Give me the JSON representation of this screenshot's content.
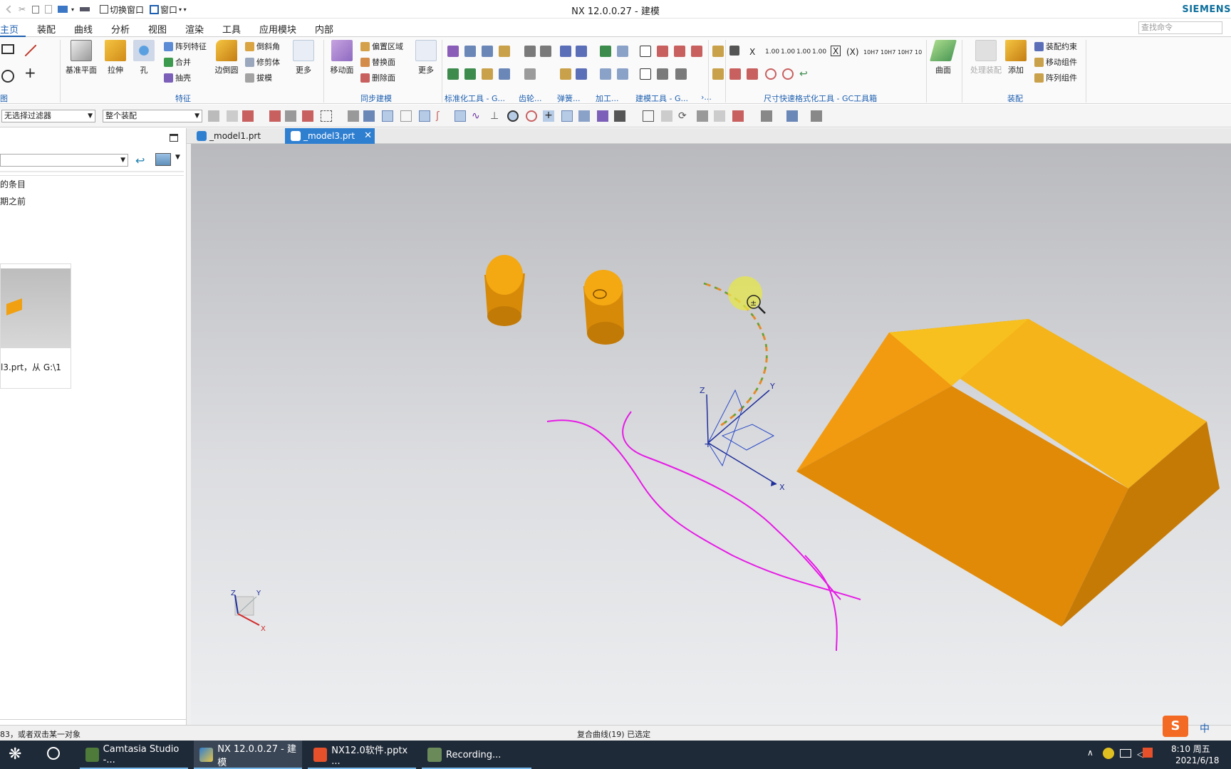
{
  "window": {
    "title": "NX 12.0.0.27 - 建模",
    "brand": "SIEMENS"
  },
  "quick_access": {
    "switch_window": "切换窗口",
    "window_menu": "窗口"
  },
  "menu": {
    "tabs": [
      "主页",
      "装配",
      "曲线",
      "分析",
      "视图",
      "渲染",
      "工具",
      "应用模块",
      "内部"
    ],
    "active": "主页",
    "search_placeholder": "查找命令"
  },
  "ribbon": {
    "groups": {
      "direct_sketch": "图",
      "feature": "特征",
      "sync_modeling": "同步建模",
      "standard_tools": "标准化工具 - G...",
      "gear": "齿轮...",
      "spring": "弹簧...",
      "machining": "加工...",
      "modeling_tools": "建模工具 - G...",
      "gc_more": "›...",
      "dimension_tools": "尺寸快速格式化工具 - GC工具箱",
      "assembly": "装配"
    },
    "feature_buttons": {
      "datum_plane": "基准平面",
      "extrude": "拉伸",
      "hole": "孔",
      "pattern_feature": "阵列特征",
      "unite": "合并",
      "shell": "抽壳",
      "edge_blend": "边倒圆",
      "chamfer": "倒斜角",
      "trim_body": "修剪体",
      "draft": "拔模",
      "more": "更多"
    },
    "sync_buttons": {
      "move_face": "移动面",
      "offset_region": "偏置区域",
      "replace_face": "替换面",
      "delete_face": "删除面",
      "more": "更多"
    },
    "dimension_labels": [
      "X",
      "1.00",
      "1.00",
      "1.00",
      "1.00",
      "X",
      "(X)",
      "10H7",
      "10H7",
      "10H7",
      "10"
    ],
    "surface_button": "曲面",
    "assembly_buttons": {
      "wave_geometry": "处理装配",
      "add": "添加",
      "assembly_constraint": "装配约束",
      "move_component": "移动组件",
      "pattern_component": "阵列组件"
    }
  },
  "selection_bar": {
    "filter": "无选择过滤器",
    "scope": "整个装配"
  },
  "navigator": {
    "items": [
      "的条目",
      "期之前"
    ],
    "preview_caption": "l3.prt，从 G:\\1"
  },
  "document_tabs": [
    {
      "name": "_model1.prt",
      "active": false
    },
    {
      "name": "_model3.prt",
      "active": true
    }
  ],
  "viewport": {
    "csys_labels": {
      "x": "X",
      "y": "Y",
      "z": "Z"
    },
    "triad_labels": {
      "x": "X",
      "y": "Y",
      "z": "Z"
    }
  },
  "status": {
    "prompt": "83，或者双击某一对象",
    "selection": "复合曲线(19) 已选定"
  },
  "taskbar": {
    "apps": [
      "Camtasia Studio -...",
      "NX 12.0.0.27 - 建模",
      "NX12.0软件.pptx ...",
      "Recording..."
    ],
    "ime": "中",
    "time": "8:10 周五",
    "date": "2021/6/18"
  },
  "colors": {
    "accent": "#1d5fb0",
    "solid": "#f0a010",
    "curve": "#e61be6",
    "taskbar": "#1f2a38"
  }
}
